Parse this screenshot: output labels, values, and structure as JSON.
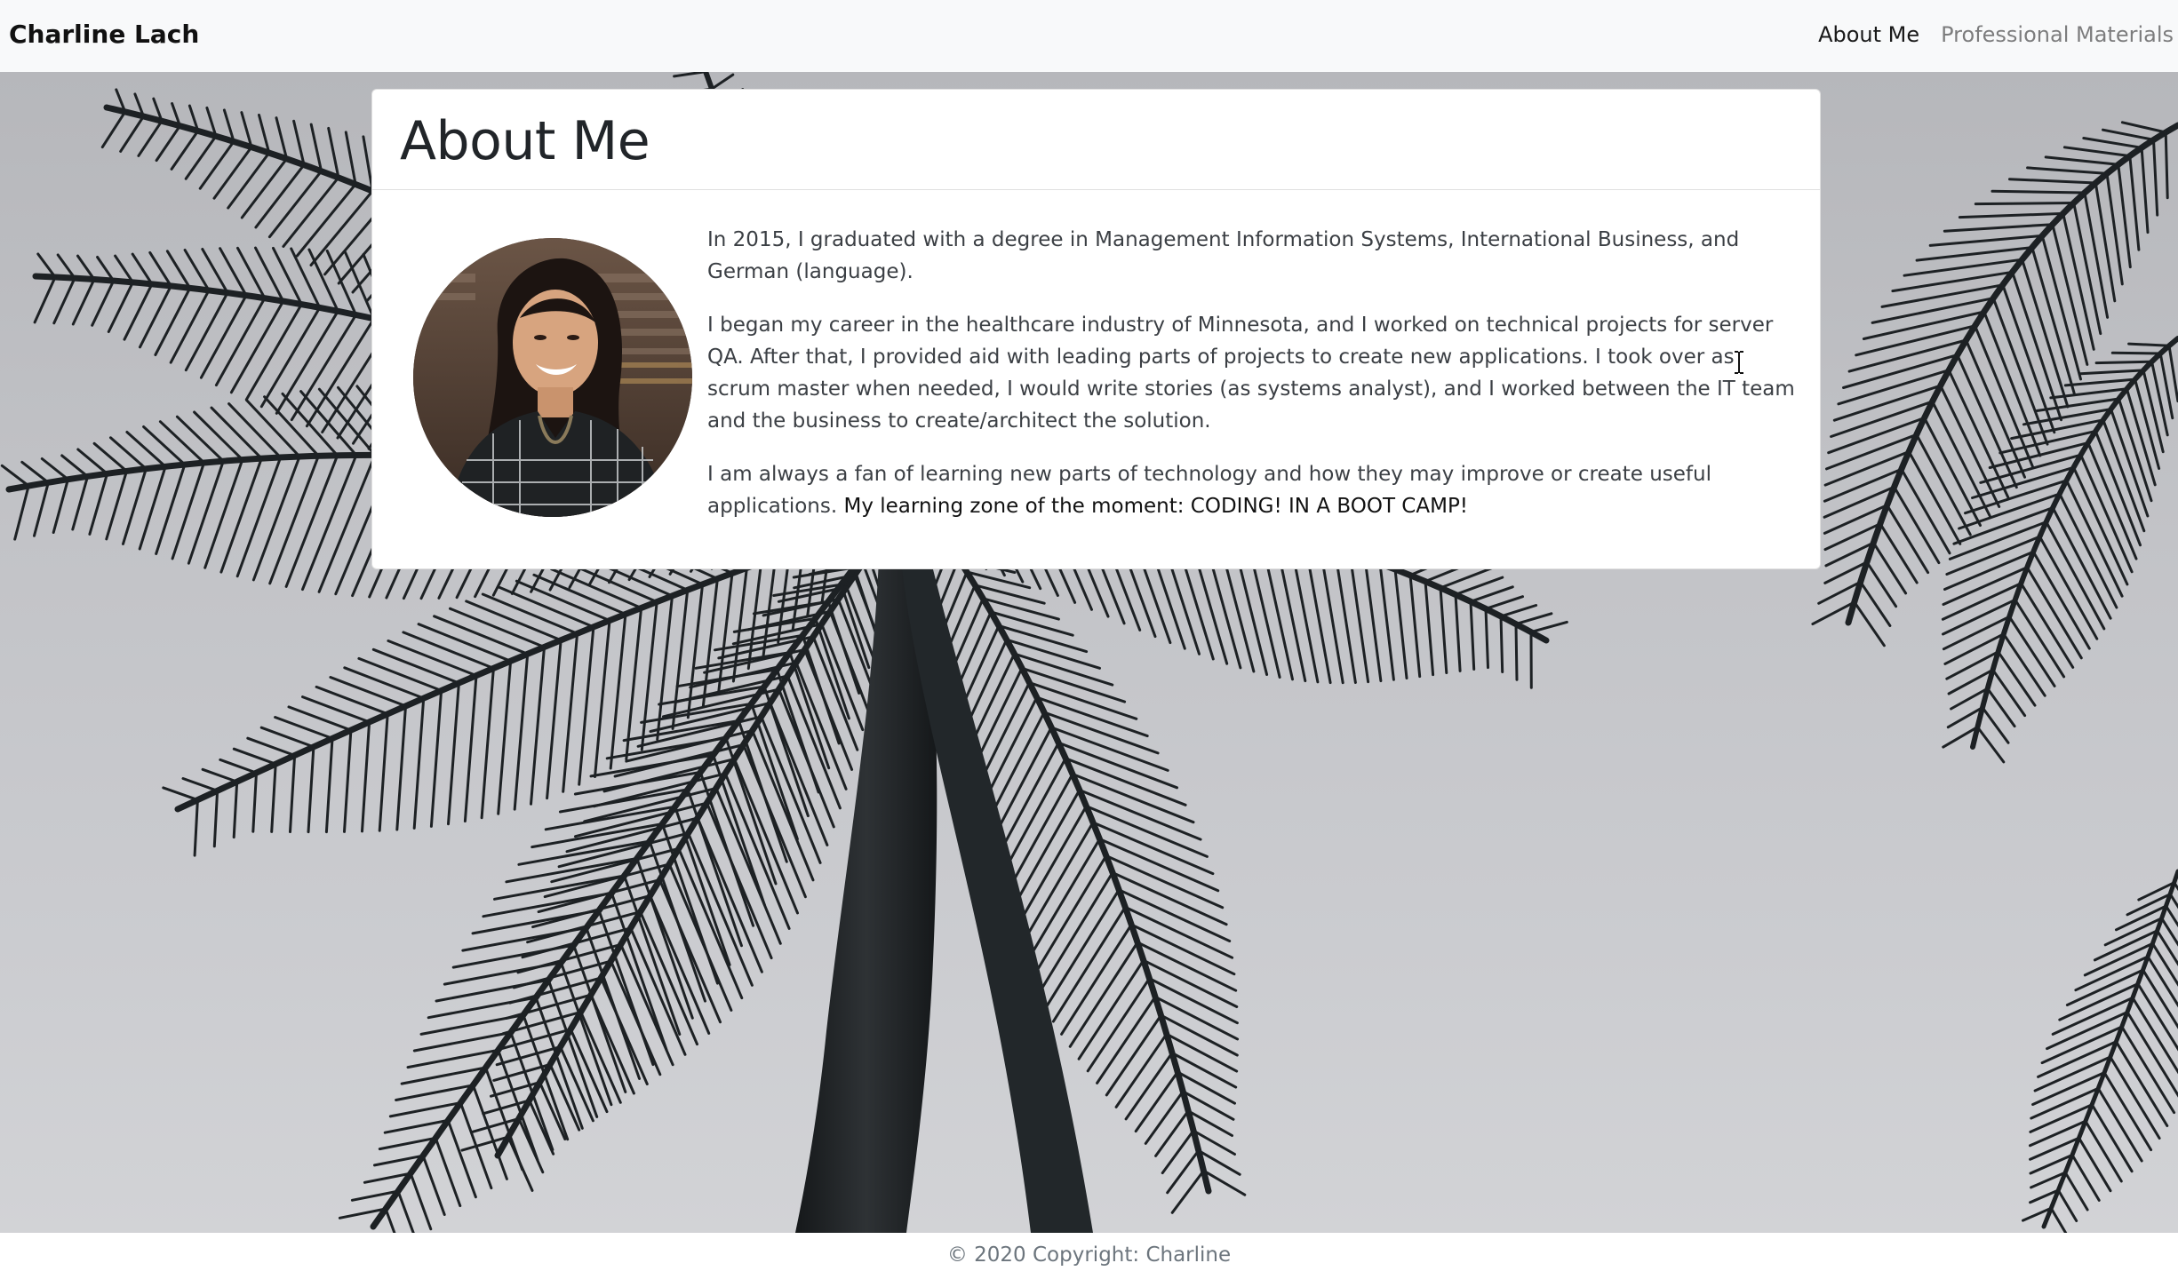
{
  "navbar": {
    "brand": "Charline Lach",
    "links": [
      {
        "label": "About Me",
        "active": true
      },
      {
        "label": "Professional Materials",
        "active": false
      }
    ]
  },
  "about": {
    "title": "About Me",
    "avatar_alt": "Portrait of Charline",
    "paragraphs": {
      "p1": "In 2015, I graduated with a degree in Management Information Systems, International Business, and German (language).",
      "p2": "I began my career in the healthcare industry of Minnesota, and I worked on technical projects for server QA. After that, I provided aid with leading parts of projects to create new applications. I took over as scrum master when needed, I would write stories (as systems analyst), and I worked between the IT team and the business to create/architect the solution.",
      "p3_intro": "I am always a fan of learning new parts of technology and how they may improve or create useful applications.",
      "p3_emphasis": "My learning zone of the moment: CODING! IN A BOOT CAMP!"
    }
  },
  "footer": {
    "copyright": "© 2020 Copyright: Charline"
  },
  "colors": {
    "navbar_bg": "#f8f9fa",
    "card_bg": "#ffffff",
    "text_muted": "#6c757d",
    "sky": "#c2c3c7",
    "palm": "#1f2326"
  }
}
